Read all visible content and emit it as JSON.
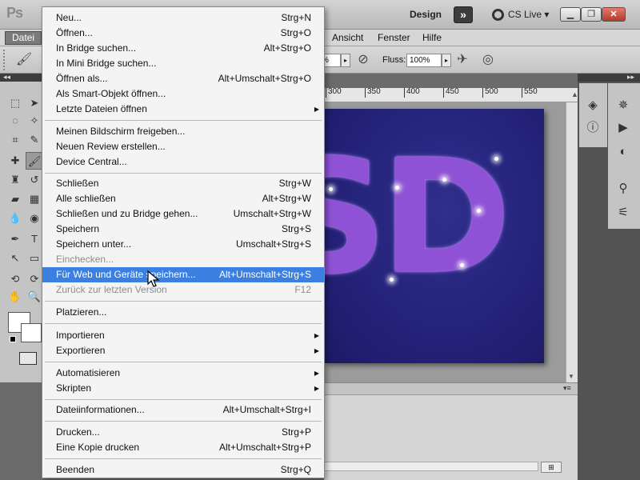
{
  "app": {
    "logo": "Ps",
    "workspace": "Design",
    "cs_live": "CS Live"
  },
  "menubar": [
    "Datei",
    "Ansicht",
    "Fenster",
    "Hilfe"
  ],
  "options": {
    "opacity_value": "%",
    "flow_label": "Fluss:",
    "flow_value": "100%"
  },
  "ruler_ticks": [
    "300",
    "350",
    "400",
    "450",
    "500",
    "550"
  ],
  "artwork_text": "SD",
  "menu": {
    "items": [
      {
        "label": "Neu...",
        "shortcut": "Strg+N"
      },
      {
        "label": "Öffnen...",
        "shortcut": "Strg+O"
      },
      {
        "label": "In Bridge suchen...",
        "shortcut": "Alt+Strg+O"
      },
      {
        "label": "In Mini Bridge suchen...",
        "shortcut": ""
      },
      {
        "label": "Öffnen als...",
        "shortcut": "Alt+Umschalt+Strg+O"
      },
      {
        "label": "Als Smart-Objekt öffnen...",
        "shortcut": ""
      },
      {
        "label": "Letzte Dateien öffnen",
        "shortcut": ""
      },
      {
        "label": "Meinen Bildschirm freigeben...",
        "shortcut": ""
      },
      {
        "label": "Neuen Review erstellen...",
        "shortcut": ""
      },
      {
        "label": "Device Central...",
        "shortcut": ""
      },
      {
        "label": "Schließen",
        "shortcut": "Strg+W"
      },
      {
        "label": "Alle schließen",
        "shortcut": "Alt+Strg+W"
      },
      {
        "label": "Schließen und zu Bridge gehen...",
        "shortcut": "Umschalt+Strg+W"
      },
      {
        "label": "Speichern",
        "shortcut": "Strg+S"
      },
      {
        "label": "Speichern unter...",
        "shortcut": "Umschalt+Strg+S"
      },
      {
        "label": "Einchecken...",
        "shortcut": ""
      },
      {
        "label": "Für Web und Geräte speichern...",
        "shortcut": "Alt+Umschalt+Strg+S"
      },
      {
        "label": "Zurück zur letzten Version",
        "shortcut": "F12"
      },
      {
        "label": "Platzieren...",
        "shortcut": ""
      },
      {
        "label": "Importieren",
        "shortcut": ""
      },
      {
        "label": "Exportieren",
        "shortcut": ""
      },
      {
        "label": "Automatisieren",
        "shortcut": ""
      },
      {
        "label": "Skripten",
        "shortcut": ""
      },
      {
        "label": "Dateiinformationen...",
        "shortcut": "Alt+Umschalt+Strg+I"
      },
      {
        "label": "Drucken...",
        "shortcut": "Strg+P"
      },
      {
        "label": "Eine Kopie drucken",
        "shortcut": "Alt+Umschalt+Strg+P"
      },
      {
        "label": "Beenden",
        "shortcut": "Strg+Q"
      }
    ]
  }
}
